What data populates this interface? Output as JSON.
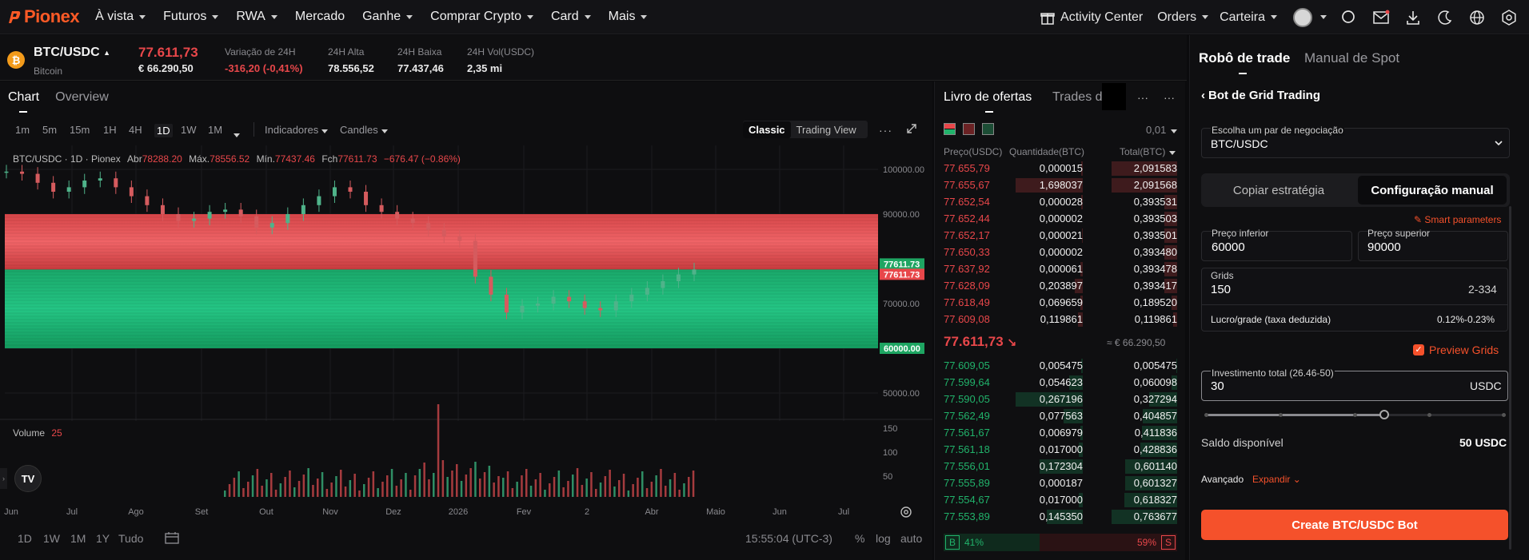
{
  "nav": {
    "brand": "Pionex",
    "items": [
      {
        "label": "À vista",
        "caret": true
      },
      {
        "label": "Futuros",
        "caret": true
      },
      {
        "label": "RWA",
        "caret": true
      },
      {
        "label": "Mercado",
        "caret": false
      },
      {
        "label": "Ganhe",
        "caret": true
      },
      {
        "label": "Comprar Crypto",
        "caret": true
      },
      {
        "label": "Card",
        "caret": true
      },
      {
        "label": "Mais",
        "caret": true
      }
    ],
    "activity_center": "Activity Center",
    "orders": "Orders",
    "wallet": "Carteira"
  },
  "ticker": {
    "pair": "BTC/USDC",
    "name": "Bitcoin",
    "price": "77.611,73",
    "price_eur": "€ 66.290,50",
    "change_label": "Variação de 24H",
    "change_value": "-316,20 (-0,41%)",
    "high_label": "24H Alta",
    "high_value": "78.556,52",
    "low_label": "24H Baixa",
    "low_value": "77.437,46",
    "vol_label": "24H Vol(USDC)",
    "vol_value": "2,35 mi"
  },
  "chart_tabs": {
    "chart": "Chart",
    "overview": "Overview"
  },
  "chart_toolbar": {
    "intervals": [
      "1m",
      "5m",
      "15m",
      "1H",
      "4H",
      "1D",
      "1W",
      "1M"
    ],
    "active_interval": "1D",
    "indicators": "Indicadores",
    "candles": "Candles",
    "classic": "Classic",
    "tradingview": "Trading View"
  },
  "chart_legend": {
    "symbol": "BTC/USDC · 1D · Pionex",
    "open_label": "Abr",
    "open": "78288.20",
    "high_label": "Máx.",
    "high": "78556.52",
    "low_label": "Mín.",
    "low": "77437.46",
    "close_label": "Fch",
    "close": "77611.73",
    "change": "−676.47 (−0.86%)",
    "volume_label": "Volume",
    "volume_value": "25"
  },
  "chart_data": {
    "type": "candlestick",
    "y_ticks": [
      "100000.00",
      "90000.00",
      "70000.00",
      "50000.00"
    ],
    "ylim": [
      45000,
      105000
    ],
    "x_ticks": [
      "Jun",
      "Jul",
      "Ago",
      "Set",
      "Out",
      "Nov",
      "Dez",
      "2026",
      "Fev",
      "2",
      "Abr",
      "Maio",
      "Jun",
      "Jul"
    ],
    "grid_upper": 90000,
    "grid_lower": 60000,
    "current_price": 77611.73,
    "price_tags": [
      "77611.73",
      "77611.73",
      "60000.00"
    ],
    "volume_ticks": [
      "150",
      "100",
      "50"
    ],
    "series": [
      {
        "name": "close",
        "values": [
          99500,
          99000,
          97000,
          95000,
          96000,
          97500,
          98000,
          96000,
          94000,
          92000,
          90000,
          88500,
          89000,
          90500,
          91000,
          89500,
          87000,
          88000,
          90000,
          92000,
          94000,
          96000,
          95000,
          92000,
          90500,
          89000,
          88000,
          86500,
          85000,
          84000,
          76000,
          72000,
          68000,
          69500,
          70000,
          71500,
          70500,
          69000,
          68500,
          70500,
          72000,
          73500,
          75000,
          76500,
          77611
        ]
      }
    ]
  },
  "chart_bottom": {
    "ranges": [
      "1D",
      "1W",
      "1M",
      "1Y",
      "Tudo"
    ],
    "time": "15:55:04 (UTC-3)",
    "pct": "%",
    "log": "log",
    "auto": "auto"
  },
  "orderbook": {
    "tab_active": "Livro de ofertas",
    "tab_other": "Trades de",
    "decimal": "0,01",
    "col_price": "Preço(USDC)",
    "col_qty": "Quantidade(BTC)",
    "col_total": "Total(BTC)",
    "asks": [
      {
        "price": "77.655,79",
        "qty": "0,000015",
        "total": "2,091583",
        "qfill": 0.02,
        "tfill": 1.0
      },
      {
        "price": "77.655,67",
        "qty": "1,698037",
        "total": "2,091568",
        "qfill": 1.0,
        "tfill": 1.0
      },
      {
        "price": "77.652,54",
        "qty": "0,000028",
        "total": "0,393531",
        "qfill": 0.02,
        "tfill": 0.19
      },
      {
        "price": "77.652,44",
        "qty": "0,000002",
        "total": "0,393503",
        "qfill": 0.0,
        "tfill": 0.19
      },
      {
        "price": "77.652,17",
        "qty": "0,000021",
        "total": "0,393501",
        "qfill": 0.01,
        "tfill": 0.19
      },
      {
        "price": "77.650,33",
        "qty": "0,000002",
        "total": "0,393480",
        "qfill": 0.0,
        "tfill": 0.19
      },
      {
        "price": "77.637,92",
        "qty": "0,000061",
        "total": "0,393478",
        "qfill": 0.03,
        "tfill": 0.19
      },
      {
        "price": "77.628,09",
        "qty": "0,203897",
        "total": "0,393417",
        "qfill": 0.12,
        "tfill": 0.19
      },
      {
        "price": "77.618,49",
        "qty": "0,069659",
        "total": "0,189520",
        "qfill": 0.04,
        "tfill": 0.09
      },
      {
        "price": "77.609,08",
        "qty": "0,119861",
        "total": "0,119861",
        "qfill": 0.07,
        "tfill": 0.06
      }
    ],
    "mid_price": "77.611,73",
    "mid_eur": "≈ € 66.290,50",
    "bids": [
      {
        "price": "77.609,05",
        "qty": "0,005475",
        "total": "0,005475",
        "qfill": 0.02,
        "tfill": 0.01
      },
      {
        "price": "77.599,64",
        "qty": "0,054623",
        "total": "0,060098",
        "qfill": 0.2,
        "tfill": 0.08
      },
      {
        "price": "77.590,05",
        "qty": "0,267196",
        "total": "0,327294",
        "qfill": 1.0,
        "tfill": 0.43
      },
      {
        "price": "77.562,49",
        "qty": "0,077563",
        "total": "0,404857",
        "qfill": 0.29,
        "tfill": 0.53
      },
      {
        "price": "77.561,67",
        "qty": "0,006979",
        "total": "0,411836",
        "qfill": 0.03,
        "tfill": 0.54
      },
      {
        "price": "77.561,18",
        "qty": "0,017000",
        "total": "0,428836",
        "qfill": 0.06,
        "tfill": 0.56
      },
      {
        "price": "77.556,01",
        "qty": "0,172304",
        "total": "0,601140",
        "qfill": 0.64,
        "tfill": 0.79
      },
      {
        "price": "77.555,89",
        "qty": "0,000187",
        "total": "0,601327",
        "qfill": 0.0,
        "tfill": 0.79
      },
      {
        "price": "77.554,67",
        "qty": "0,017000",
        "total": "0,618327",
        "qfill": 0.06,
        "tfill": 0.81
      },
      {
        "price": "77.553,89",
        "qty": "0,145350",
        "total": "0,763677",
        "qfill": 0.54,
        "tfill": 1.0
      }
    ],
    "buy_label": "B",
    "buy_pct": "41%",
    "sell_pct": "59%",
    "sell_label": "S",
    "buy_ratio": 0.41
  },
  "bot": {
    "tab_active": "Robô de trade",
    "tab_other": "Manual de Spot",
    "back_title": "Bot de Grid Trading",
    "pair_label": "Escolha um par de negociação",
    "pair_value": "BTC/USDC",
    "mode_copy": "Copiar estratégia",
    "mode_manual": "Configuração manual",
    "smart": "Smart parameters",
    "lower_label": "Preço inferior",
    "lower_value": "60000",
    "upper_label": "Preço superior",
    "upper_value": "90000",
    "grids_label": "Grids",
    "grids_value": "150",
    "grids_range": "2-334",
    "profit_label": "Lucro/grade (taxa deduzida)",
    "profit_value": "0.12%-0.23%",
    "preview": "Preview Grids",
    "invest_label": "Investimento total (26.46-50)",
    "invest_value": "30",
    "invest_unit": "USDC",
    "slider_value": 0.6,
    "balance_label": "Saldo disponível",
    "balance_value": "50 USDC",
    "advanced_label": "Avançado",
    "expand": "Expandir",
    "create": "Create BTC/USDC Bot"
  },
  "colors": {
    "accent": "#ff5a26",
    "up": "#21b36b",
    "down": "#e8474a"
  }
}
